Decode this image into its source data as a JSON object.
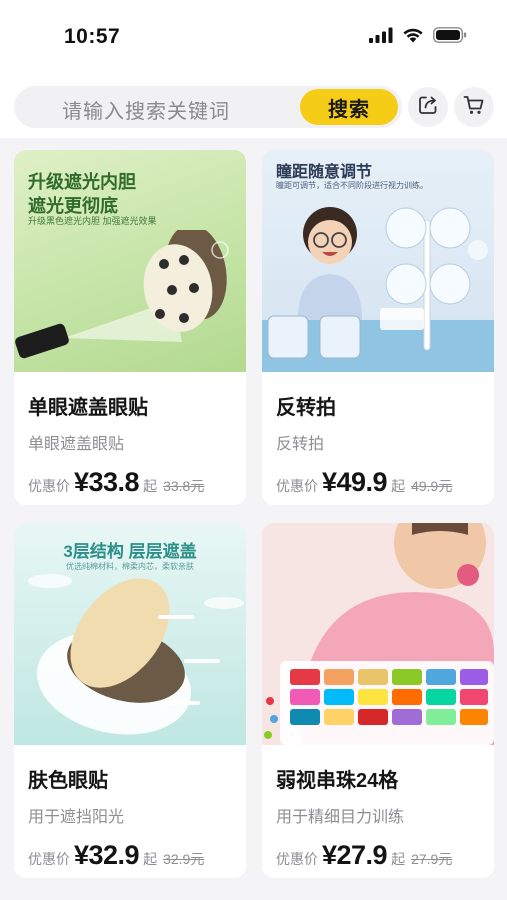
{
  "status": {
    "time": "10:57"
  },
  "search": {
    "placeholder": "请输入搜索关键词",
    "button_label": "搜索"
  },
  "icons": {
    "share": "share-icon",
    "cart": "cart-icon",
    "signal": "signal-icon",
    "wifi": "wifi-icon",
    "battery": "battery-icon"
  },
  "colors": {
    "accent": "#F5CC16",
    "price": "#141414",
    "muted": "#8E8E93",
    "background": "#F4F4F6"
  },
  "products": [
    {
      "image_caption": "升级遮光内胆",
      "image_caption2": "遮光更彻底",
      "image_note": "升级黑色遮光内胆 加强遮光效果",
      "title": "单眼遮盖眼贴",
      "subtitle": "单眼遮盖眼贴",
      "price_label": "优惠价",
      "price": "¥33.8",
      "price_suffix": "起",
      "original_price": "33.8元"
    },
    {
      "image_caption": "瞳距随意调节",
      "image_note": "瞳距可调节，适合不同阶段进行视力训练。",
      "title": "反转拍",
      "subtitle": "反转拍",
      "price_label": "优惠价",
      "price": "¥49.9",
      "price_suffix": "起",
      "original_price": "49.9元"
    },
    {
      "image_caption": "3层结构 层层遮盖",
      "image_note": "优选纯棉材料，棉柔内芯，柔软亲肤",
      "title": "肤色眼贴",
      "subtitle": "用于遮挡阳光",
      "price_label": "优惠价",
      "price": "¥32.9",
      "price_suffix": "起",
      "original_price": "32.9元"
    },
    {
      "title": "弱视串珠24格",
      "subtitle": "用于精细目力训练",
      "price_label": "优惠价",
      "price": "¥27.9",
      "price_suffix": "起",
      "original_price": "27.9元"
    }
  ]
}
